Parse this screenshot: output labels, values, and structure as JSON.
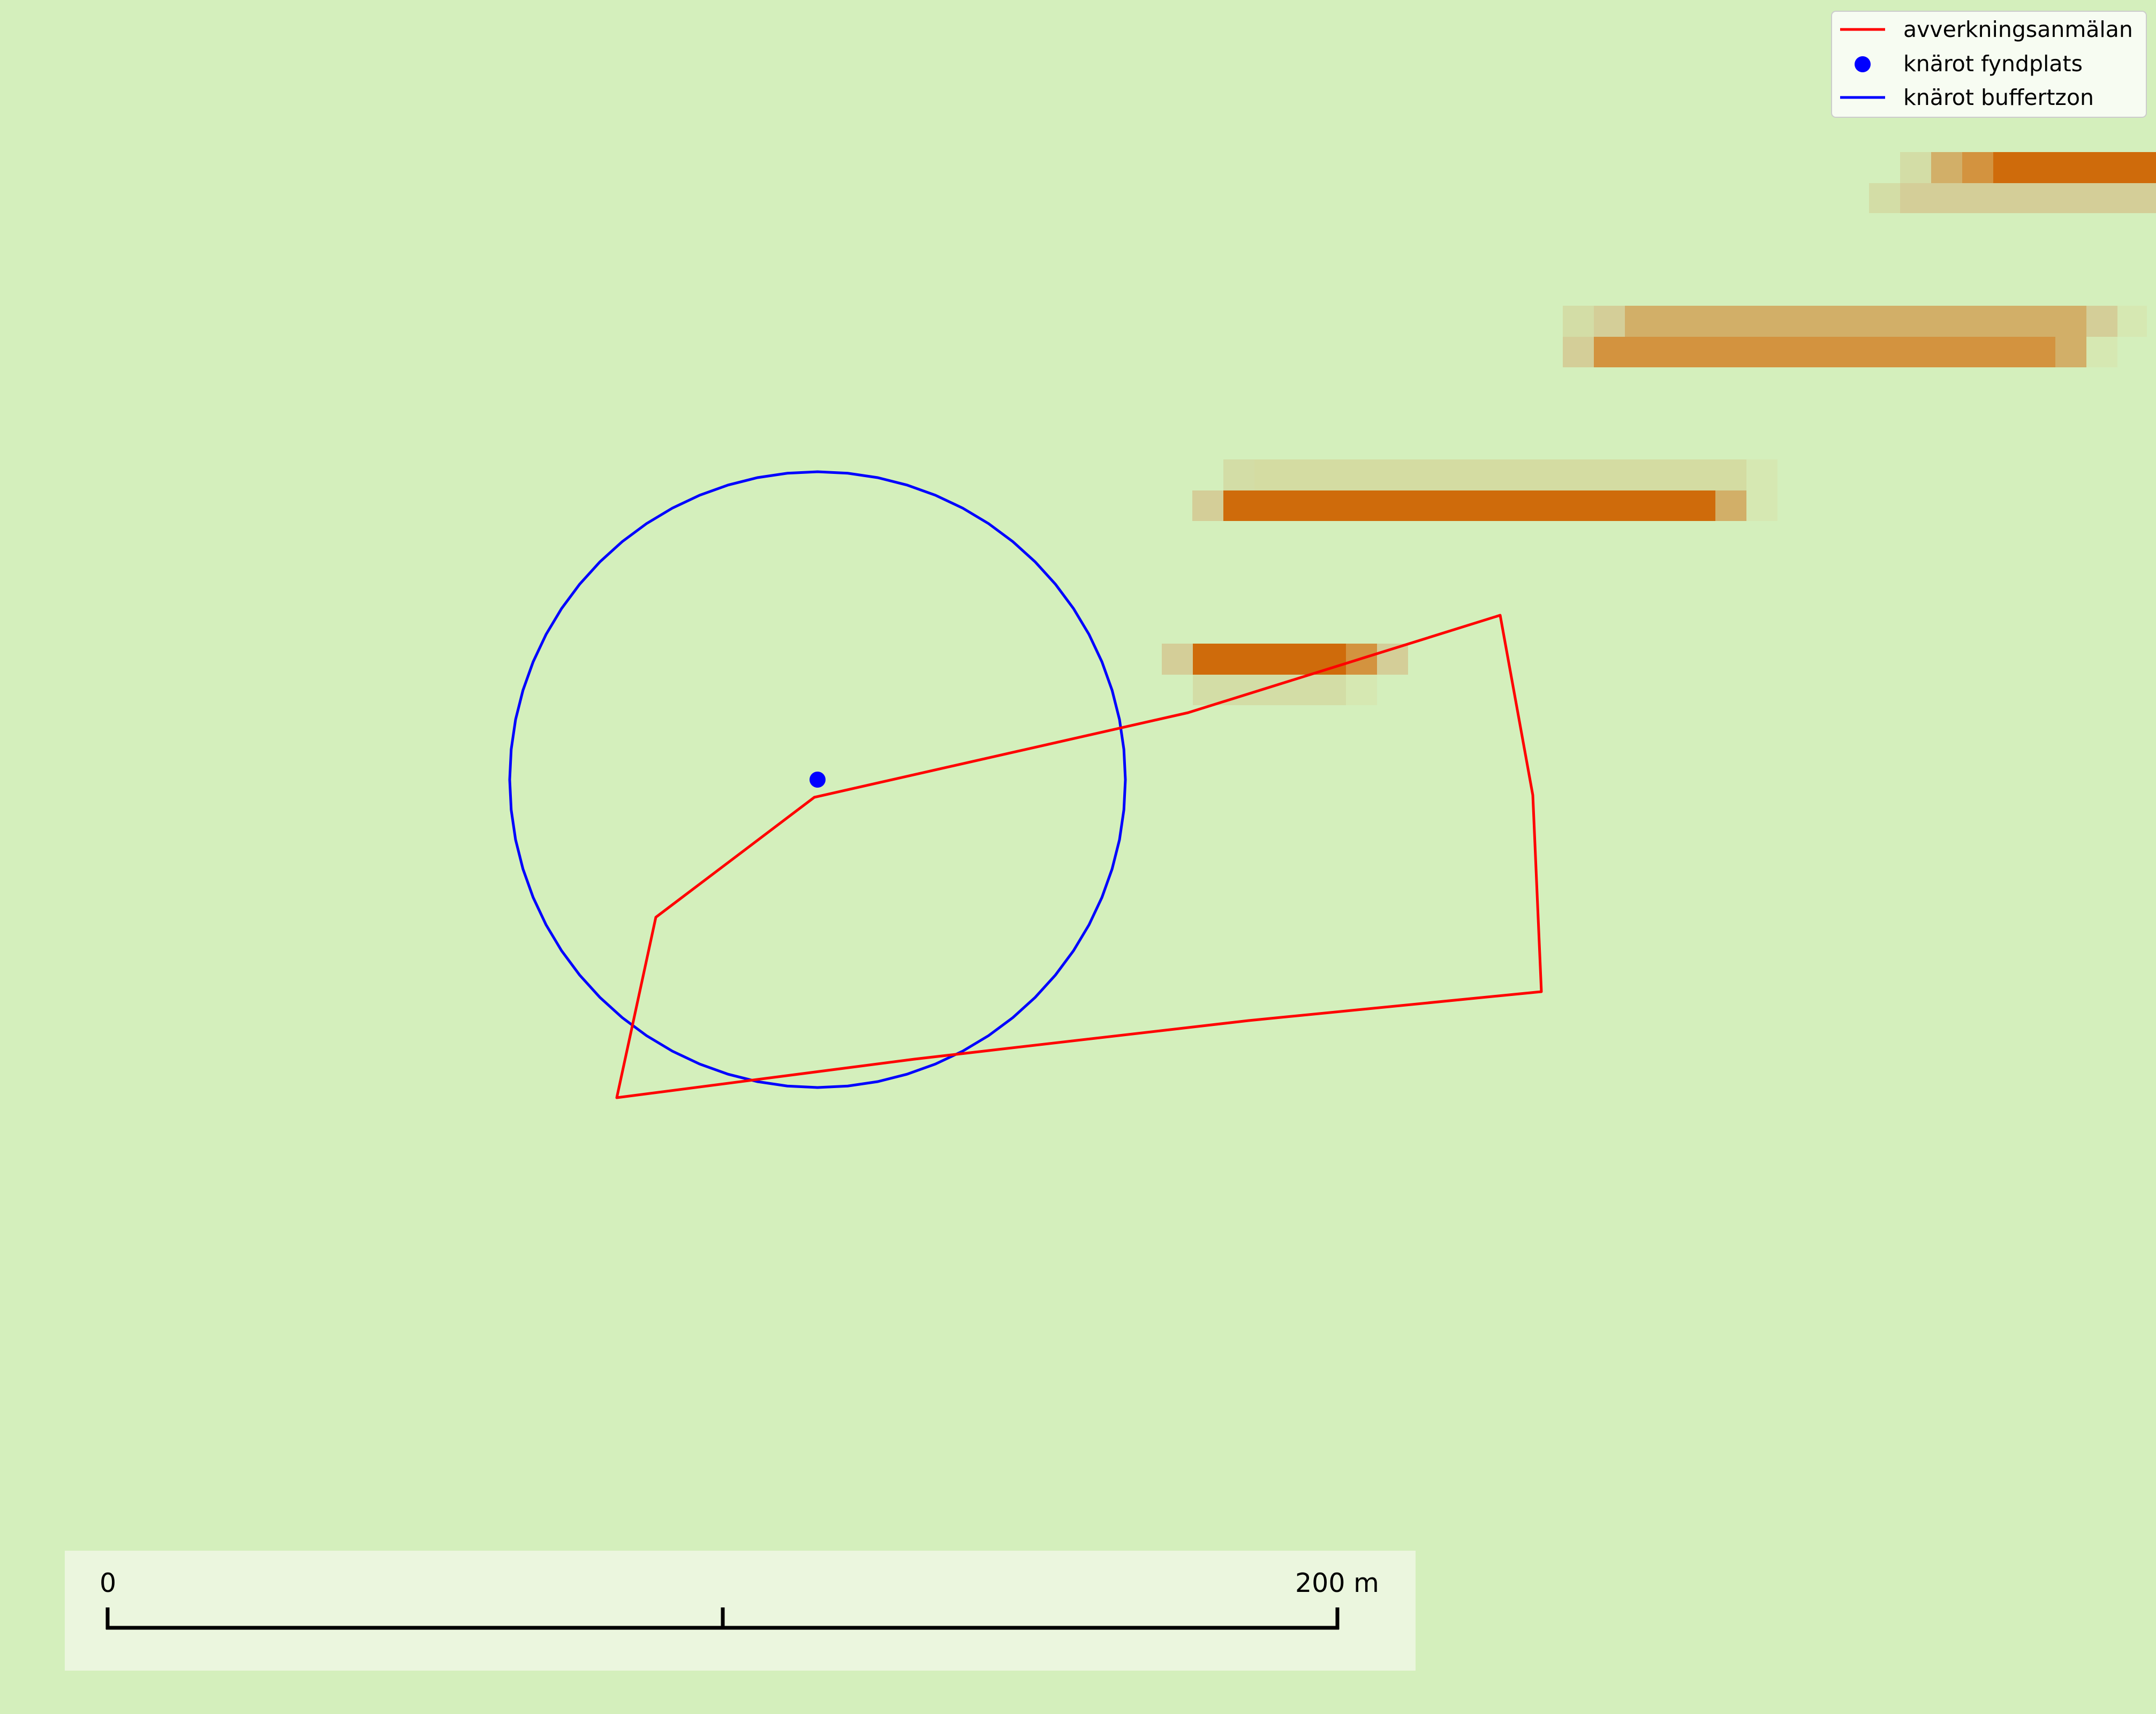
{
  "map": {
    "background_color": "#d4efbc",
    "raster_colors": {
      "strong": "#cf6b0b",
      "medium": "#d3933f",
      "light": "#d2af68",
      "faint": "#d4ce98",
      "fainter": "#d3dda6",
      "edge": "#d6e8b2"
    }
  },
  "legend": {
    "items": [
      {
        "label": "avverkningsanmälan",
        "symbol": "line",
        "color": "#ff0000"
      },
      {
        "label": "knärot fyndplats",
        "symbol": "point",
        "color": "#0000ff"
      },
      {
        "label": "knärot buffertzon",
        "symbol": "line",
        "color": "#0000ff"
      }
    ]
  },
  "layers": {
    "avverkningsanmalan": {
      "color": "#ff0000"
    },
    "knarot_fyndplats": {
      "color": "#0000ff"
    },
    "knarot_buffertzon": {
      "color": "#0000ff"
    }
  },
  "scalebar": {
    "start_label": "0",
    "end_label": "200 m",
    "length_m": 200
  }
}
